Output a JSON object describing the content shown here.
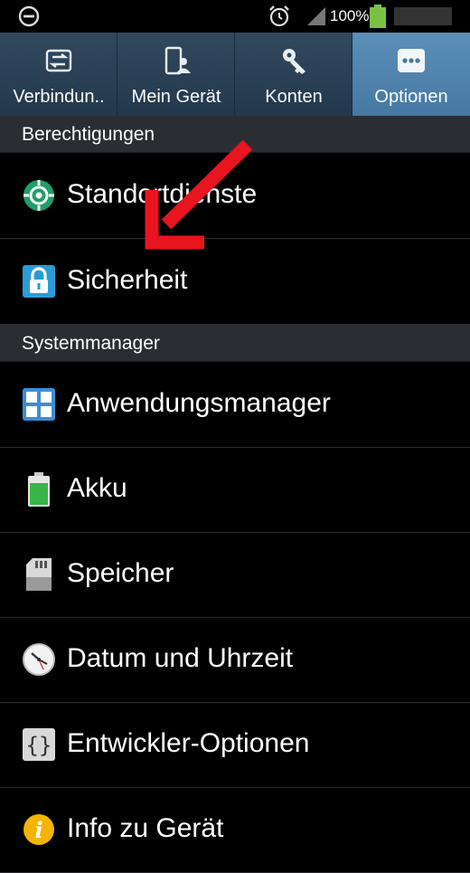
{
  "status_bar": {
    "battery_percent": "100%"
  },
  "tabs": [
    {
      "label": "Verbindun..",
      "icon": "connections-icon",
      "active": false
    },
    {
      "label": "Mein Gerät",
      "icon": "device-icon",
      "active": false
    },
    {
      "label": "Konten",
      "icon": "key-icon",
      "active": false
    },
    {
      "label": "Optionen",
      "icon": "more-options-icon",
      "active": true
    }
  ],
  "sections": [
    {
      "title": "Berechtigungen",
      "items": [
        {
          "label": "Standortdienste",
          "icon": "location-icon"
        },
        {
          "label": "Sicherheit",
          "icon": "lock-icon"
        }
      ]
    },
    {
      "title": "Systemmanager",
      "items": [
        {
          "label": "Anwendungsmanager",
          "icon": "apps-grid-icon"
        },
        {
          "label": "Akku",
          "icon": "battery-icon"
        },
        {
          "label": "Speicher",
          "icon": "sd-card-icon"
        },
        {
          "label": "Datum und Uhrzeit",
          "icon": "clock-icon"
        },
        {
          "label": "Entwickler-Optionen",
          "icon": "braces-icon"
        },
        {
          "label": "Info zu Gerät",
          "icon": "info-icon"
        }
      ]
    }
  ],
  "colors": {
    "active_tab": "#4678a3",
    "tab_bg": "#283d52",
    "section_bg": "#2a2e33",
    "arrow": "#e8141e"
  }
}
